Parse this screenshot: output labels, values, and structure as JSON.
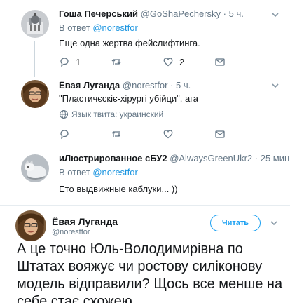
{
  "tweet1": {
    "name": "Гоша Печерський",
    "handle": "@GoShaPechersky",
    "dot": "·",
    "time": "5 ч.",
    "reply_prefix": "В ответ",
    "reply_mention": "@norestfor",
    "text": "Еще одна жертва фейслифтинга.",
    "reply_count": "1",
    "retweet_count": "",
    "like_count": "2"
  },
  "tweet2": {
    "name": "Ёвая Луганда",
    "handle": "@norestfor",
    "dot": "·",
    "time": "5 ч.",
    "text": "\"Пластичєскіє-хірургі убійци\", ага",
    "language_note": "Язык твита: украинский"
  },
  "tweet3": {
    "name": "иЛюстрированное сБУ2",
    "handle": "@AlwaysGreenUkr2",
    "dot": "·",
    "time": "25 мин.",
    "reply_prefix": "В ответ",
    "reply_mention": "@norestfor",
    "text": "Ето выдвижные каблуки... ))"
  },
  "main_tweet": {
    "name": "Ёвая Луганда",
    "handle": "@norestfor",
    "follow_label": "Читать",
    "text": "А це точно Юль-Володимирівна по Штатах вояжує чи ростову силіконову модель відправили? Щось все менше на себе стає схожею."
  },
  "icons": {
    "reply": "reply-icon",
    "retweet": "retweet-icon",
    "like": "heart-icon",
    "dm": "envelope-icon",
    "more": "chevron-down-icon",
    "globe": "globe-icon"
  },
  "colors": {
    "link": "#1b95e0",
    "muted": "#657786",
    "accent": "#1da1f2",
    "text": "#14171a"
  }
}
